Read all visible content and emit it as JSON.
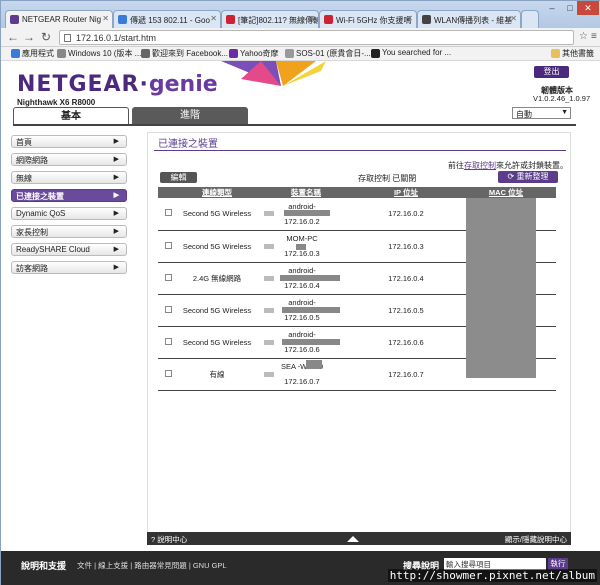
{
  "tabs": [
    {
      "title": "NETGEAR Router Nig",
      "color": "#5b3d8c"
    },
    {
      "title": "傳遞 153 802.11 - Goo",
      "color": "#3a7ad8"
    },
    {
      "title": "[筆記]802.11? 無線傳輸",
      "color": "#c23"
    },
    {
      "title": "Wi-Fi 5GHz 你支援嗎",
      "color": "#c23"
    },
    {
      "title": "WLAN傳播列表 - 維基",
      "color": "#444"
    }
  ],
  "url": "172.16.0.1/start.htm",
  "bookmarks": [
    "應用程式",
    "Windows 10 (版本 ...",
    "歡迎來到 Facebook...",
    "Yahoo奇摩",
    "SOS-01 (原貴會日-...",
    "You searched for ..."
  ],
  "other_bookmarks": "其他書籤",
  "logo": {
    "brand": "NETGEAR",
    "product": "genie"
  },
  "model": "Nighthawk X6 R8000",
  "logout": "登出",
  "firmware_label": "韌體版本",
  "firmware_version": "V1.0.2.46_1.0.97",
  "mode_select": "自動",
  "main_tabs": {
    "basic": "基本",
    "advanced": "進階"
  },
  "sidebar": [
    "首頁",
    "網際網路",
    "無線",
    "已連接之裝置",
    "Dynamic QoS",
    "家長控制",
    "ReadySHARE Cloud",
    "訪客網路"
  ],
  "panel": {
    "title": "已連接之裝置",
    "notice_pre": "前往",
    "notice_link": "存取控制",
    "notice_post": "來允許或封鎖裝置。",
    "edit": "編輯",
    "access_status": "存取控制 已關閉",
    "refresh": "重新整理",
    "headers": [
      "連線類型",
      "裝置名稱",
      "IP 位址",
      "MAC 位址"
    ],
    "rows": [
      {
        "type": "Second 5G Wireless",
        "name": "android-",
        "name_ip": "172.16.0.2",
        "ip": "172.16.0.2"
      },
      {
        "type": "Second 5G Wireless",
        "name": "MOM-PC",
        "name_ip": "172.16.0.3",
        "ip": "172.16.0.3"
      },
      {
        "type": "2.4G 無線網路",
        "name": "android-",
        "name_ip": "172.16.0.4",
        "ip": "172.16.0.4"
      },
      {
        "type": "Second 5G Wireless",
        "name": "android-",
        "name_ip": "172.16.0.5",
        "ip": "172.16.0.5"
      },
      {
        "type": "Second 5G Wireless",
        "name": "android-",
        "name_ip": "172.16.0.6",
        "ip": "172.16.0.6"
      },
      {
        "type": "有線",
        "name": "SEA   -WIN10",
        "name_ip": "172.16.0.7",
        "ip": "172.16.0.7"
      }
    ]
  },
  "help": {
    "left": "說明中心",
    "right": "顯示/隱藏說明中心"
  },
  "footer": {
    "title": "說明和支援",
    "links": "文件 | 線上支援 | 路由器常見問題 | GNU GPL",
    "search_title": "搜尋說明",
    "search_placeholder": "輸入搜尋項目",
    "go": "執行"
  },
  "watermark": "http://showmer.pixnet.net/album"
}
